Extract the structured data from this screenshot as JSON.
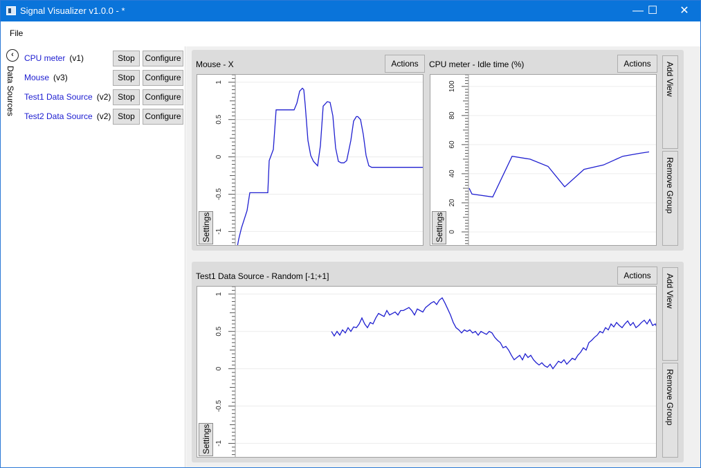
{
  "window": {
    "title": "Signal Visualizer v1.0.0 - *",
    "controls": {
      "minimize": "—",
      "maximize": "☐",
      "close": "✕"
    }
  },
  "menu": {
    "file": "File"
  },
  "left_panel": {
    "collapse_glyph": "‹",
    "title": "Data Sources",
    "sources": [
      {
        "name": "CPU meter",
        "version": "(v1)",
        "stop": "Stop",
        "configure": "Configure"
      },
      {
        "name": "Mouse",
        "version": "(v3)",
        "stop": "Stop",
        "configure": "Configure"
      },
      {
        "name": "Test1 Data Source",
        "version": "(v2)",
        "stop": "Stop",
        "configure": "Configure"
      },
      {
        "name": "Test2 Data Source",
        "version": "(v2)",
        "stop": "Stop",
        "configure": "Configure"
      }
    ]
  },
  "groups": [
    {
      "add_view": "Add View",
      "remove_group": "Remove Group",
      "views": [
        {
          "title": "Mouse - X",
          "actions": "Actions",
          "settings": "Settings",
          "y_ticks": [
            "1",
            "0.5",
            "0",
            "-0.5",
            "-1"
          ]
        },
        {
          "title": "CPU meter - Idle time (%)",
          "actions": "Actions",
          "settings": "Settings",
          "y_ticks": [
            "100",
            "80",
            "60",
            "40",
            "20",
            "0"
          ]
        }
      ]
    },
    {
      "add_view": "Add View",
      "remove_group": "Remove Group",
      "views": [
        {
          "title": "Test1 Data Source - Random [-1;+1]",
          "actions": "Actions",
          "settings": "Settings",
          "y_ticks": [
            "1",
            "0.5",
            "0",
            "-0.5",
            "-1"
          ]
        }
      ]
    }
  ],
  "colors": {
    "titlebar": "#0a74da",
    "link": "#1b1bd0",
    "series": "#1f1fd0"
  },
  "chart_data": [
    {
      "type": "line",
      "ylim": [
        -1.2,
        1.1
      ],
      "x": [
        0,
        2,
        6,
        14,
        18,
        44,
        46,
        52,
        56,
        82,
        86,
        90,
        94,
        96,
        98,
        102,
        106,
        110,
        116,
        120,
        124,
        130,
        134,
        138,
        142,
        146,
        150,
        154,
        158,
        164,
        168,
        172,
        174,
        178,
        182,
        186,
        190,
        194,
        198,
        202,
        270
      ],
      "values": [
        -1.2,
        -1.1,
        -0.95,
        -0.72,
        -0.48,
        -0.48,
        -0.05,
        0.1,
        0.63,
        0.63,
        0.72,
        0.88,
        0.92,
        0.9,
        0.7,
        0.22,
        0.02,
        -0.06,
        -0.12,
        0.15,
        0.68,
        0.74,
        0.73,
        0.55,
        0.12,
        -0.06,
        -0.08,
        -0.08,
        -0.05,
        0.22,
        0.48,
        0.54,
        0.54,
        0.5,
        0.3,
        0.02,
        -0.12,
        -0.14,
        -0.14,
        -0.14,
        -0.14
      ]
    },
    {
      "type": "line",
      "ylim": [
        -10,
        108
      ],
      "x": [
        0,
        4,
        34,
        62,
        88,
        114,
        138,
        166,
        194,
        222,
        246,
        260
      ],
      "values": [
        30,
        26,
        24,
        52,
        50,
        45,
        31,
        43,
        46,
        52,
        54,
        55
      ]
    },
    {
      "type": "line",
      "ylim": [
        -1.2,
        1.1
      ],
      "x": [
        0,
        4,
        8,
        12,
        16,
        20,
        24,
        28,
        32,
        36,
        40,
        44,
        48,
        52,
        56,
        60,
        64,
        68,
        72,
        76,
        80,
        84,
        88,
        92,
        96,
        100,
        104,
        108,
        112,
        116,
        120,
        124,
        128,
        132,
        136,
        140,
        144,
        148,
        152,
        156,
        160,
        164,
        168,
        172,
        176,
        180,
        184,
        188,
        192,
        196,
        200,
        204,
        208,
        212,
        216,
        220,
        224,
        228,
        232,
        236,
        240,
        244,
        248,
        252,
        256,
        260,
        264,
        268,
        272,
        276,
        280,
        284,
        288,
        292,
        296,
        300,
        304,
        308,
        312,
        316,
        320,
        324,
        328,
        332,
        336,
        340,
        344,
        348,
        352,
        356,
        360,
        364,
        368,
        372,
        376,
        380,
        384,
        388,
        392,
        396,
        400,
        404,
        408,
        412,
        416,
        420,
        424,
        428,
        432,
        436,
        440,
        444,
        448,
        452,
        456,
        460,
        464,
        468,
        472
      ],
      "values": [
        0.5,
        0.44,
        0.5,
        0.45,
        0.52,
        0.48,
        0.55,
        0.5,
        0.56,
        0.55,
        0.6,
        0.68,
        0.6,
        0.55,
        0.62,
        0.6,
        0.68,
        0.74,
        0.72,
        0.7,
        0.78,
        0.72,
        0.74,
        0.76,
        0.72,
        0.78,
        0.78,
        0.8,
        0.82,
        0.78,
        0.72,
        0.8,
        0.78,
        0.76,
        0.82,
        0.85,
        0.88,
        0.9,
        0.86,
        0.92,
        0.95,
        0.88,
        0.8,
        0.72,
        0.62,
        0.55,
        0.52,
        0.48,
        0.52,
        0.5,
        0.52,
        0.48,
        0.5,
        0.45,
        0.5,
        0.48,
        0.46,
        0.5,
        0.48,
        0.42,
        0.38,
        0.35,
        0.28,
        0.3,
        0.25,
        0.18,
        0.12,
        0.15,
        0.18,
        0.12,
        0.2,
        0.15,
        0.18,
        0.12,
        0.08,
        0.05,
        0.08,
        0.04,
        0.02,
        0.06,
        0.0,
        0.05,
        0.1,
        0.08,
        0.12,
        0.06,
        0.1,
        0.14,
        0.12,
        0.18,
        0.22,
        0.28,
        0.25,
        0.35,
        0.38,
        0.42,
        0.45,
        0.5,
        0.48,
        0.55,
        0.52,
        0.6,
        0.56,
        0.62,
        0.58,
        0.55,
        0.6,
        0.64,
        0.58,
        0.62,
        0.55,
        0.58,
        0.62,
        0.65,
        0.6,
        0.66,
        0.58,
        0.6,
        0.52
      ]
    }
  ]
}
